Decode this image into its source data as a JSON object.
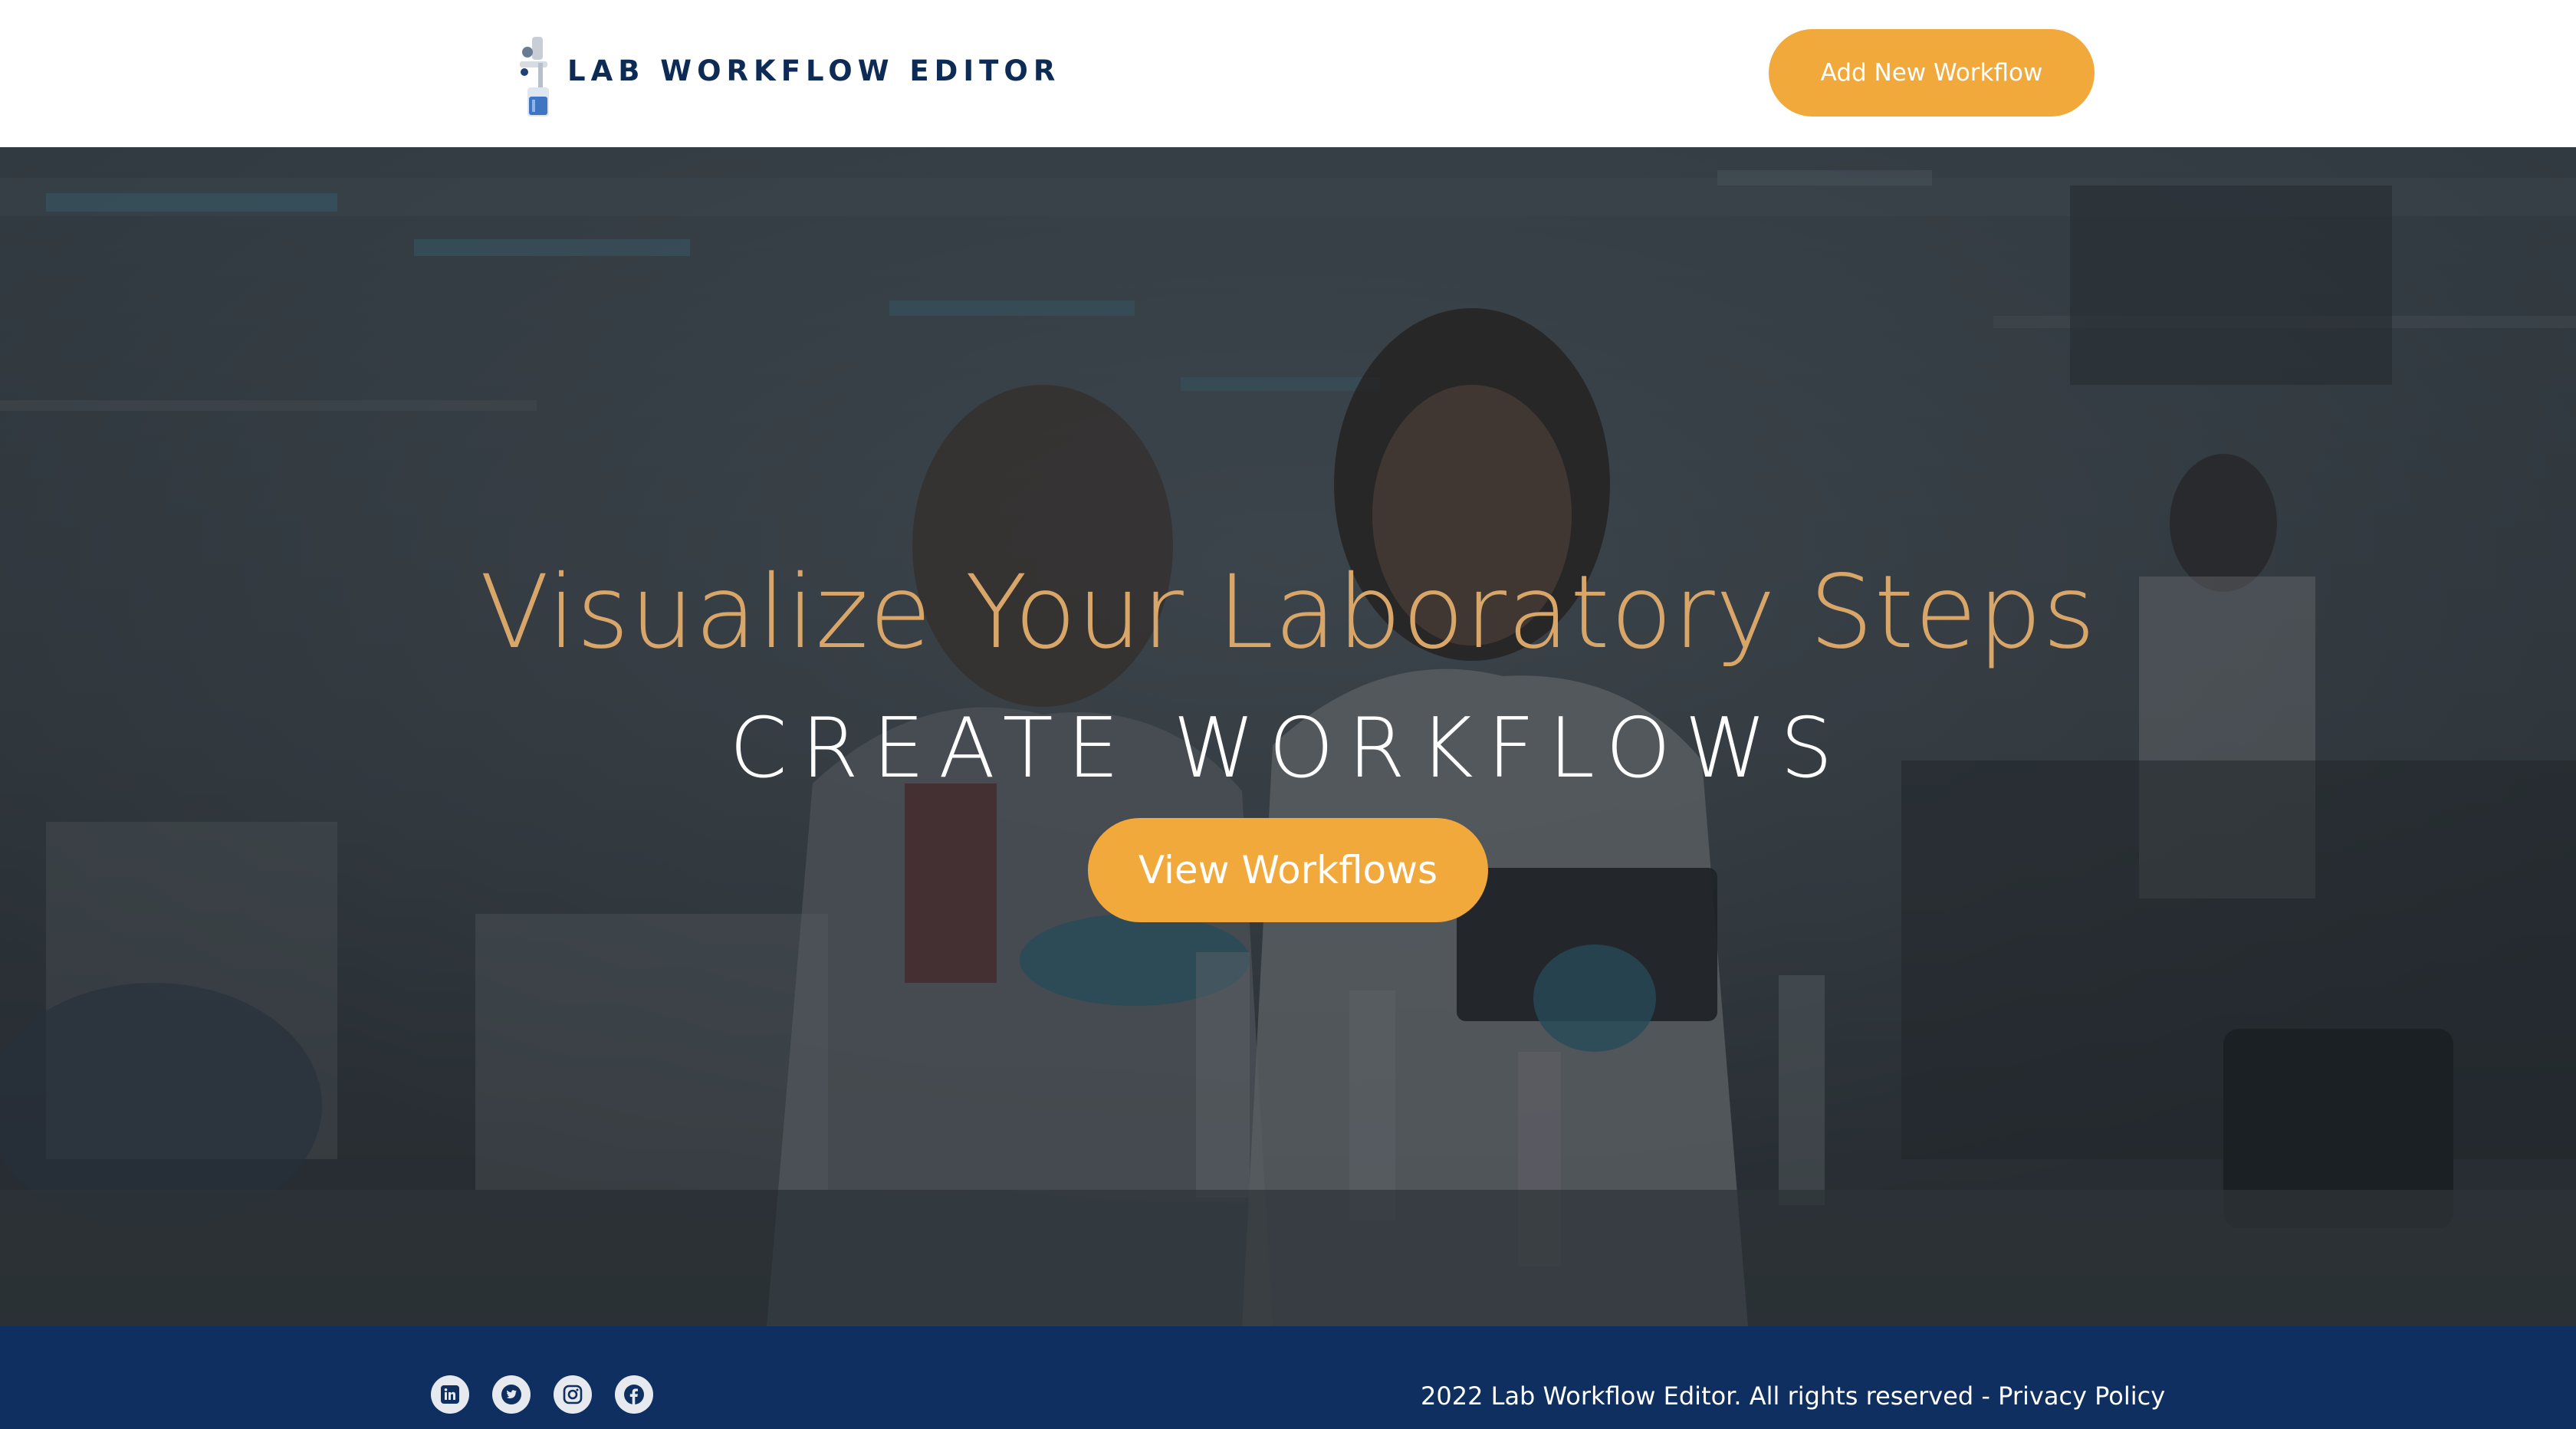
{
  "header": {
    "logo_text": "LAB WORKFLOW EDITOR",
    "add_button_label": "Add New Workflow"
  },
  "hero": {
    "title": "Visualize Your Laboratory Steps",
    "subtitle": "CREATE WORKFLOWS",
    "view_button_label": "View Workflows"
  },
  "footer": {
    "social_icons": [
      "linkedin-icon",
      "twitter-icon",
      "instagram-icon",
      "facebook-icon"
    ],
    "copyright_text": "2022 Lab Workflow Editor. All rights reserved - ",
    "privacy_link": "Privacy Policy"
  },
  "colors": {
    "accent": "#f2a93b",
    "brand_navy": "#0e2f5f",
    "hero_title": "#d9a66a",
    "logo_text": "#0d2b55"
  }
}
